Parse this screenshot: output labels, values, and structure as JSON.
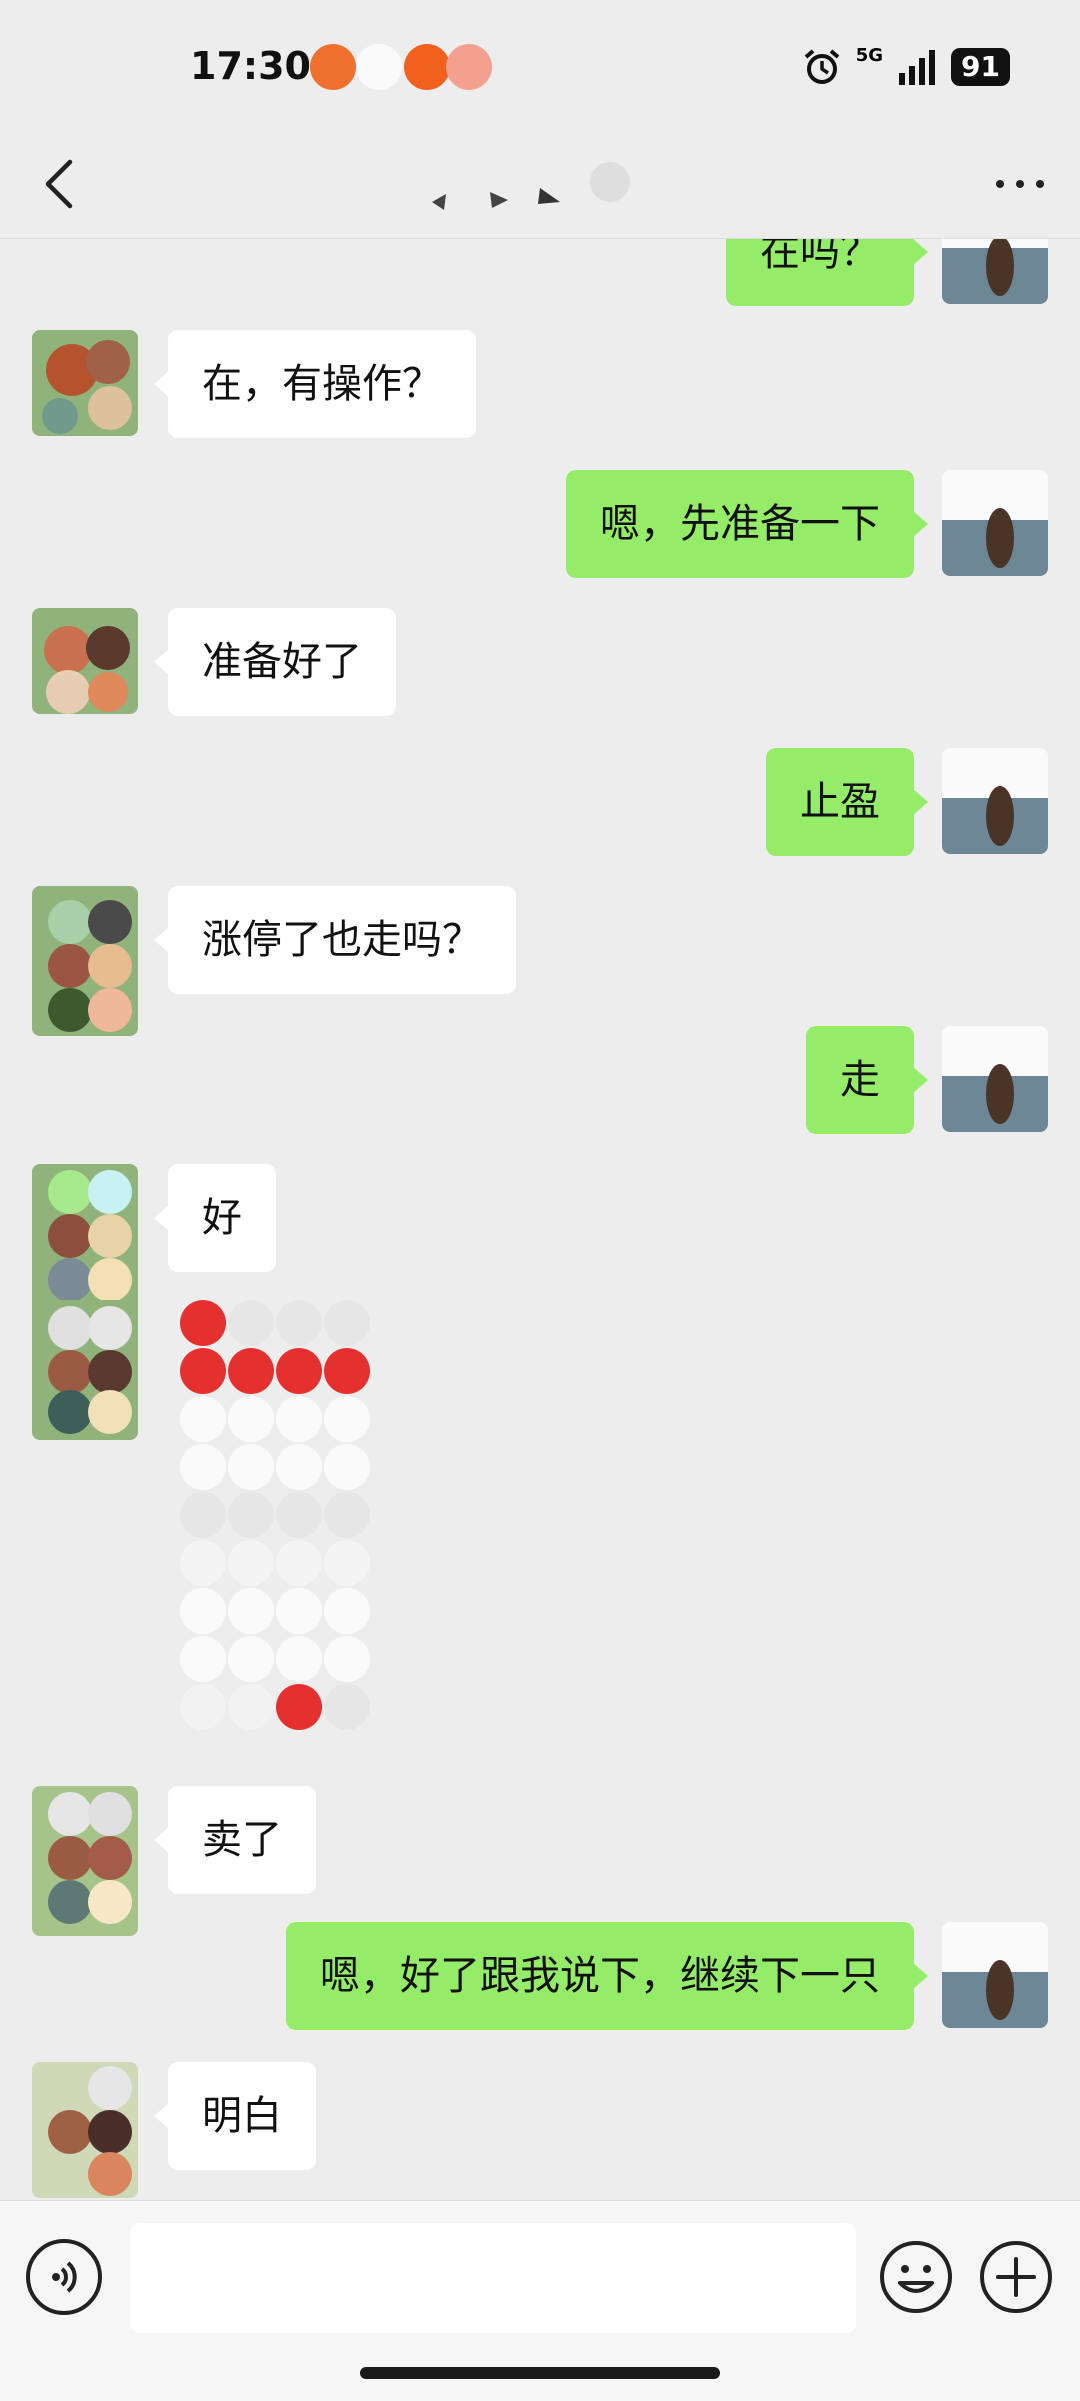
{
  "status_bar": {
    "time": "17:30",
    "network": "5G",
    "battery": "91",
    "icons": [
      "alarm-icon",
      "signal-icon",
      "battery-icon"
    ]
  },
  "header": {
    "back_icon": "chevron-left-icon",
    "more_icon": "more-horizontal-icon",
    "title": ""
  },
  "messages": [
    {
      "side": "out",
      "text": "在吗？"
    },
    {
      "side": "in",
      "text": "在，有操作？"
    },
    {
      "side": "out",
      "text": "嗯，先准备一下"
    },
    {
      "side": "in",
      "text": "准备好了"
    },
    {
      "side": "out",
      "text": "止盈"
    },
    {
      "side": "in",
      "text": "涨停了也走吗？"
    },
    {
      "side": "out",
      "text": "走"
    },
    {
      "side": "in",
      "text": "好"
    },
    {
      "side": "in",
      "text": "",
      "type": "image-redacted"
    },
    {
      "side": "in",
      "text": "卖了"
    },
    {
      "side": "out",
      "text": "嗯，好了跟我说下，继续下一只"
    },
    {
      "side": "in",
      "text": "明白"
    }
  ],
  "input_bar": {
    "voice_icon": "voice-icon",
    "emoji_icon": "emoji-icon",
    "plus_icon": "plus-icon",
    "placeholder": ""
  },
  "colors": {
    "background": "#ededed",
    "outgoing_bubble": "#95ec69",
    "incoming_bubble": "#ffffff"
  }
}
